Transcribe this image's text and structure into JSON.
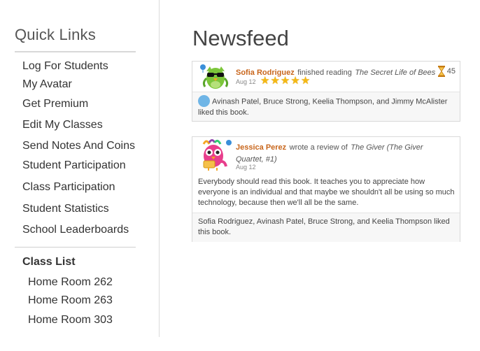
{
  "sidebar": {
    "title": "Quick Links",
    "links": [
      "Log For Students",
      "My Avatar",
      "Get Premium",
      "Edit My Classes",
      "Send Notes And Coins",
      "Student Participation",
      "Class Participation",
      "Student Statistics",
      "School Leaderboards"
    ],
    "class_list_title": "Class List",
    "rooms": [
      "Home Room 262",
      "Home Room 263",
      "Home Room 303"
    ]
  },
  "main": {
    "title": "Newsfeed",
    "feed": [
      {
        "name": "Sofia Rodriguez",
        "action": "finished reading",
        "book": "The Secret Life of Bees",
        "date": "Aug 12",
        "rating": 5,
        "minutes": "45",
        "likes": "Avinash Patel, Bruce Strong, Keelia Thompson, and Jimmy McAlister liked this book."
      },
      {
        "name": "Jessica Perez",
        "action": "wrote a review of",
        "book": "The Giver (The Giver Quartet, #1)",
        "date": "Aug 12",
        "review": "Everybody should read this book. It teaches you to appreciate how everyone is an individual and that maybe we shouldn't all be using so much technology, because then we'll all be the same.",
        "likes": "Sofia Rodriguez, Avinash Patel, Bruce Strong, and Keelia Thompson liked this book."
      }
    ]
  },
  "colors": {
    "name_accent": "#c8661c",
    "star": "#f5b914",
    "owl_green": "#7cc63a",
    "owl2_pink": "#e83e8c"
  }
}
